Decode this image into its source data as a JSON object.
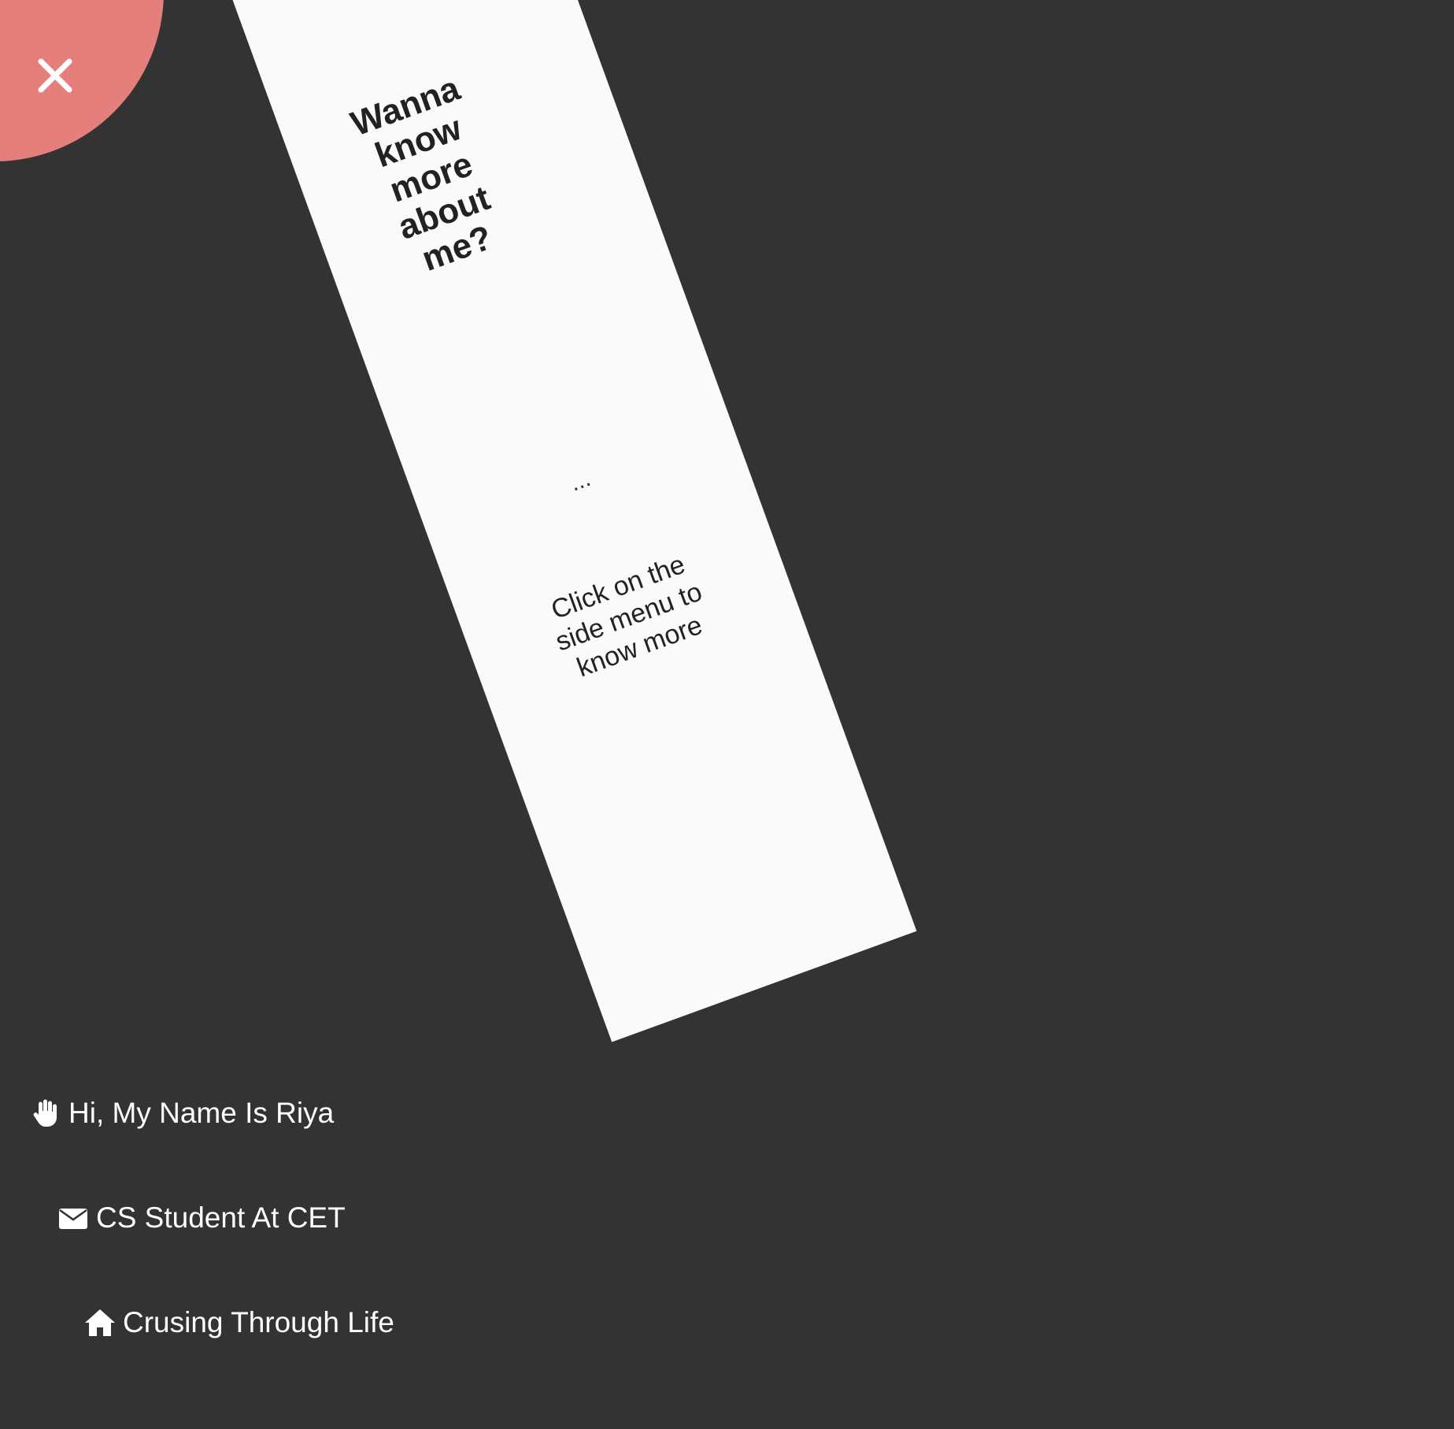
{
  "panel": {
    "heading": "Wanna know more about me?",
    "ellipsis": "...",
    "note": "Click on the side menu to know more"
  },
  "close_button": {
    "icon": "close-icon",
    "color": "#e57f7b"
  },
  "menu": {
    "items": [
      {
        "icon": "hand-icon",
        "label": "Hi, My Name Is Riya"
      },
      {
        "icon": "envelope-icon",
        "label": "CS Student At CET"
      },
      {
        "icon": "home-icon",
        "label": "Crusing Through Life"
      }
    ]
  },
  "colors": {
    "background": "#333333",
    "panel": "#fafafa",
    "accent": "#e57f7b",
    "menu_text": "#ffffff"
  }
}
